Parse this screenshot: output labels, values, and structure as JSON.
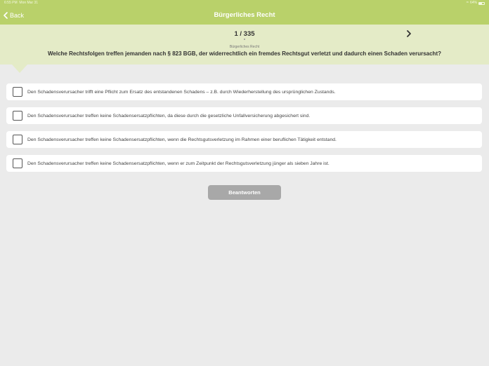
{
  "status_bar": {
    "time": "6:55 PM",
    "date": "Mon Mar 31",
    "battery": "64%",
    "battery_level_percent": 64,
    "icons": [
      "wifi-icon",
      "battery-icon"
    ]
  },
  "navbar": {
    "back_label": "Back",
    "title": "Bürgerliches Recht"
  },
  "question": {
    "pager": "1 / 335",
    "category": "Bürgerliches Recht",
    "text": "Welche Rechtsfolgen treffen jemanden nach § 823 BGB, der widerrechtlich ein fremdes Rechtsgut verletzt und dadurch einen Schaden verursacht?"
  },
  "answers": [
    {
      "text": "Den Schadensverursacher trifft eine Pflicht zum Ersatz des entstandenen Schadens – z.B. durch Wiederherstellung des ursprünglichen Zustands.",
      "checked": false
    },
    {
      "text": "Den Schadensverursacher treffen keine Schadensersatzpflichten, da diese durch die gesetzliche Unfallversicherung abgesichert sind.",
      "checked": false
    },
    {
      "text": "Den Schadensverursacher treffen keine Schadensersatzpflichten, wenn die Rechtsgutsverletzung im Rahmen einer beruflichen Tätigkeit entstand.",
      "checked": false
    },
    {
      "text": "Den Schadensverursacher treffen keine Schadensersatzpflichten, wenn er zum Zeitpunkt der Rechtsgutsverletzung jünger als sieben Jahre ist.",
      "checked": false
    }
  ],
  "submit_label": "Beantworten",
  "colors": {
    "accent": "#b9d16a",
    "header_bg": "#e4ebc7",
    "page_bg": "#ebebeb",
    "button_disabled": "#a8a8a8"
  }
}
